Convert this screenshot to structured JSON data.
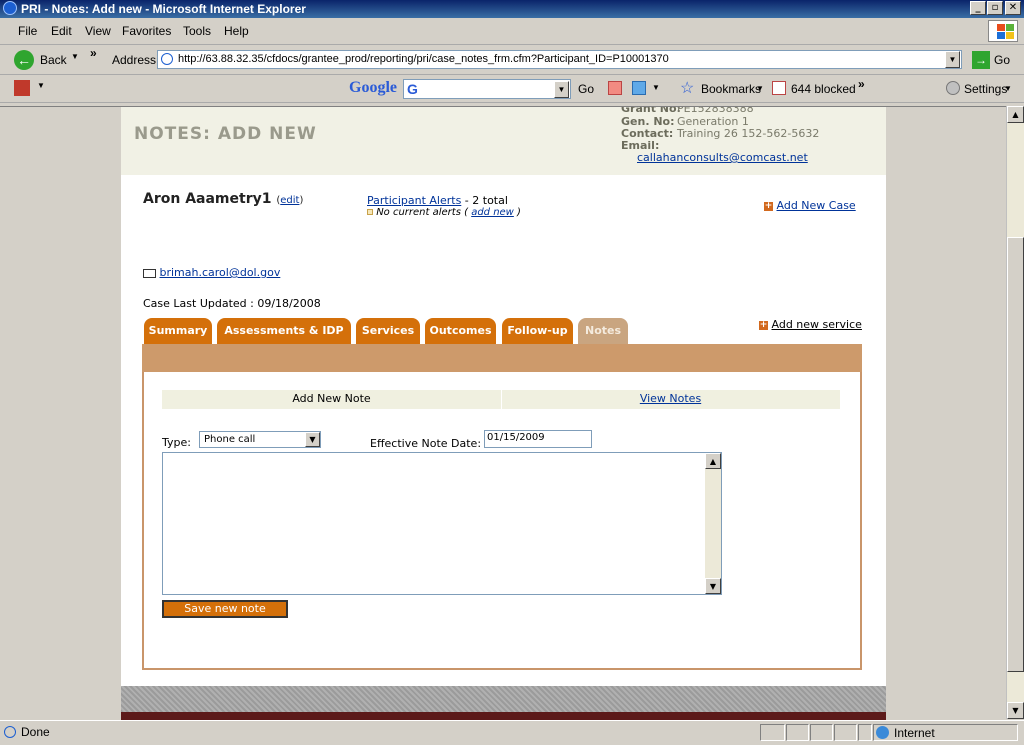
{
  "window": {
    "title": "PRI - Notes: Add new - Microsoft Internet Explorer"
  },
  "menu": {
    "items": [
      "File",
      "Edit",
      "View",
      "Favorites",
      "Tools",
      "Help"
    ]
  },
  "toolbar": {
    "back_label": "Back",
    "address_label": "Address",
    "go_label": "Go"
  },
  "address": {
    "url": "http://63.88.32.35/cfdocs/grantee_prod/reporting/pri/case_notes_frm.cfm?Participant_ID=P10001370"
  },
  "google_bar": {
    "logo": "Google",
    "go_label": "Go",
    "bookmarks_label": "Bookmarks",
    "blocked_label": "644 blocked",
    "settings_label": "Settings"
  },
  "page": {
    "title": "NOTES: ADD NEW",
    "grant_info": {
      "grant_label": "Grant No:",
      "grant_value": "PE152838388",
      "gen_label": "Gen. No:",
      "gen_value": "Generation 1",
      "contact_label": "Contact:",
      "contact_value": "Training 26  152-562-5632",
      "email_label": "Email:",
      "email_value": "callahanconsults@comcast.net"
    },
    "participant": {
      "name": "Aron Aaametry1",
      "edit_label": "edit",
      "alerts_link": "Participant Alerts",
      "alerts_total": " - 2 total",
      "no_alerts": "No current alerts",
      "add_new_label": "add new",
      "add_case_label": "Add New Case",
      "email": "brimah.carol@dol.gov",
      "case_updated": "Case Last Updated : 09/18/2008",
      "add_service_label": "Add new service"
    },
    "tabs": [
      "Summary",
      "Assessments & IDP",
      "Services",
      "Outcomes",
      "Follow-up",
      "Notes"
    ],
    "active_tab": "Notes",
    "form": {
      "subnav_add": "Add New Note",
      "subnav_view": "View Notes",
      "type_label": "Type:",
      "type_value": "Phone call",
      "date_label": "Effective Note Date:",
      "date_value": "01/15/2009",
      "note_text": "",
      "save_label": "Save new note"
    }
  },
  "status": {
    "left": "Done",
    "zone": "Internet"
  }
}
